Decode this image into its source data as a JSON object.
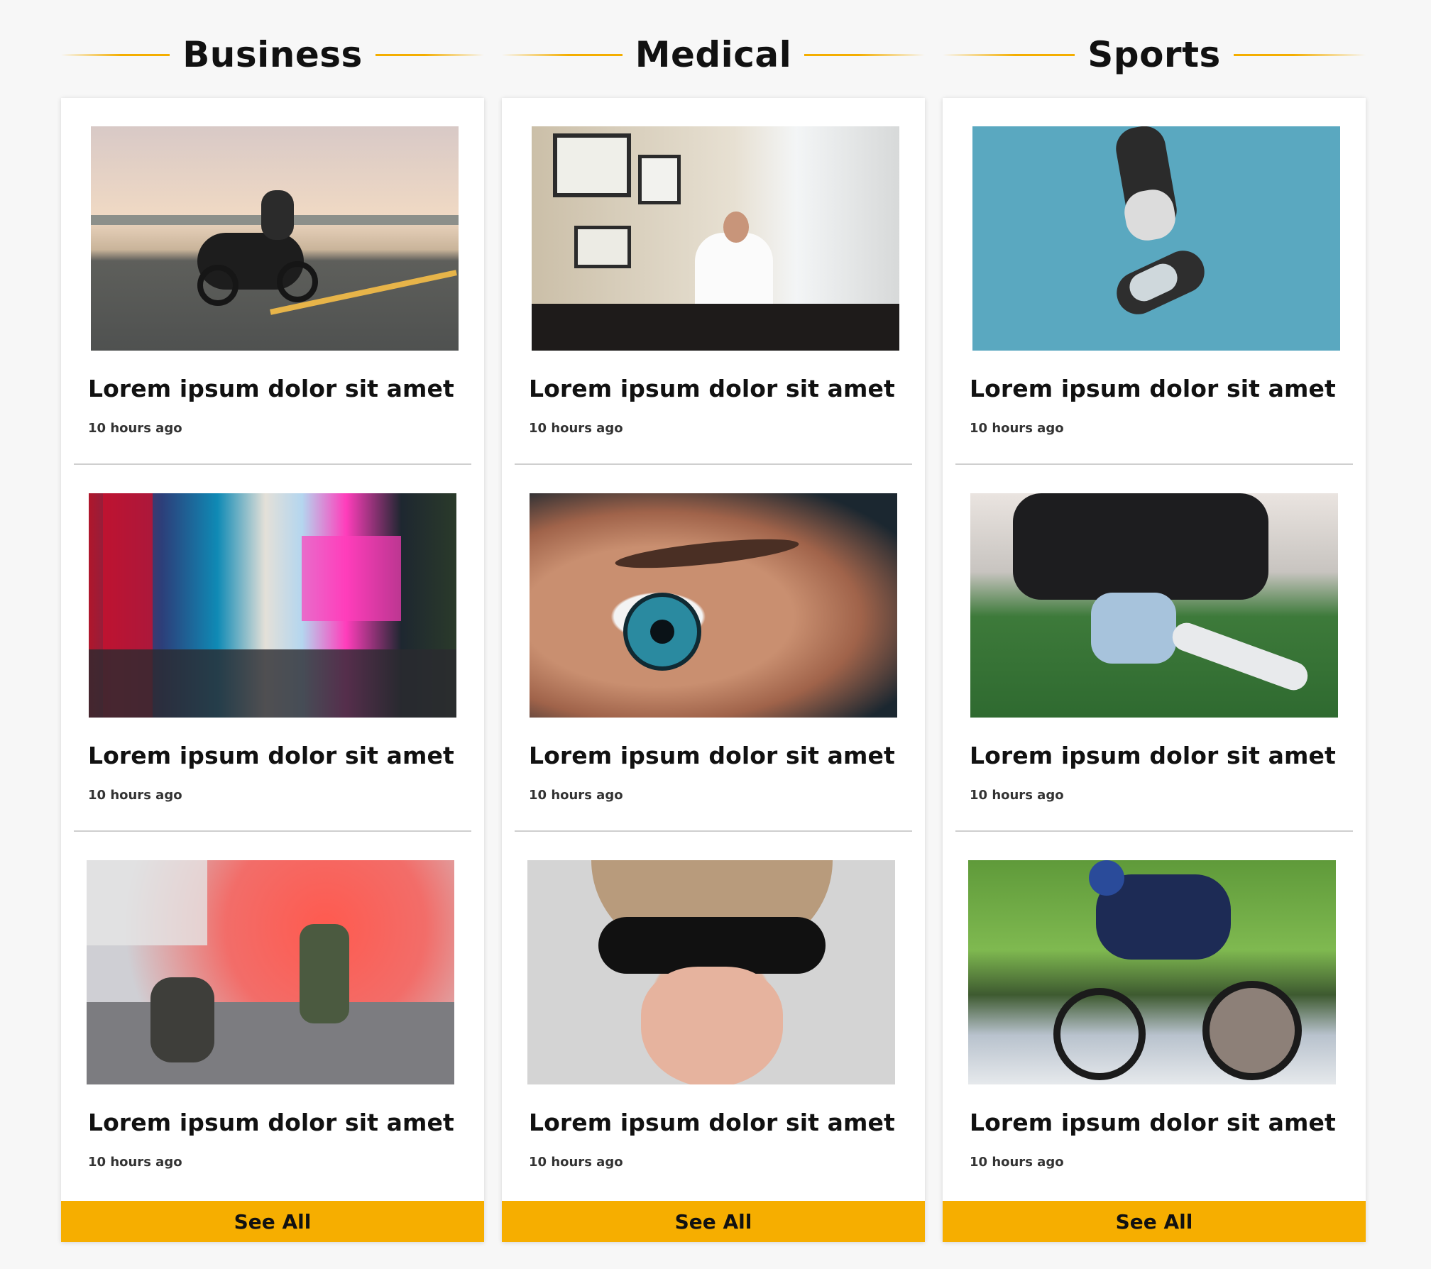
{
  "columns": [
    {
      "title": "Business",
      "articles": [
        {
          "headline": "Lorem ipsum dolor sit amet",
          "time": "10 hours ago",
          "image": "motorcycle-rider-photo"
        },
        {
          "headline": "Lorem ipsum dolor sit amet",
          "time": "10 hours ago",
          "image": "times-square-photo"
        },
        {
          "headline": "Lorem ipsum dolor sit amet",
          "time": "10 hours ago",
          "image": "historical-reenactment-photo"
        }
      ],
      "see_all": "See All"
    },
    {
      "title": "Medical",
      "articles": [
        {
          "headline": "Lorem ipsum dolor sit amet",
          "time": "10 hours ago",
          "image": "doctor-office-photo"
        },
        {
          "headline": "Lorem ipsum dolor sit amet",
          "time": "10 hours ago",
          "image": "eye-closeup-photo"
        },
        {
          "headline": "Lorem ipsum dolor sit amet",
          "time": "10 hours ago",
          "image": "woman-visor-photo"
        }
      ],
      "see_all": "See All"
    },
    {
      "title": "Sports",
      "articles": [
        {
          "headline": "Lorem ipsum dolor sit amet",
          "time": "10 hours ago",
          "image": "flying-shoes-photo"
        },
        {
          "headline": "Lorem ipsum dolor sit amet",
          "time": "10 hours ago",
          "image": "soccer-player-photo"
        },
        {
          "headline": "Lorem ipsum dolor sit amet",
          "time": "10 hours ago",
          "image": "cyclist-photo"
        }
      ],
      "see_all": "See All"
    }
  ],
  "colors": {
    "accent": "#f6ae00",
    "card": "#ffffff",
    "background": "#f7f7f7"
  }
}
